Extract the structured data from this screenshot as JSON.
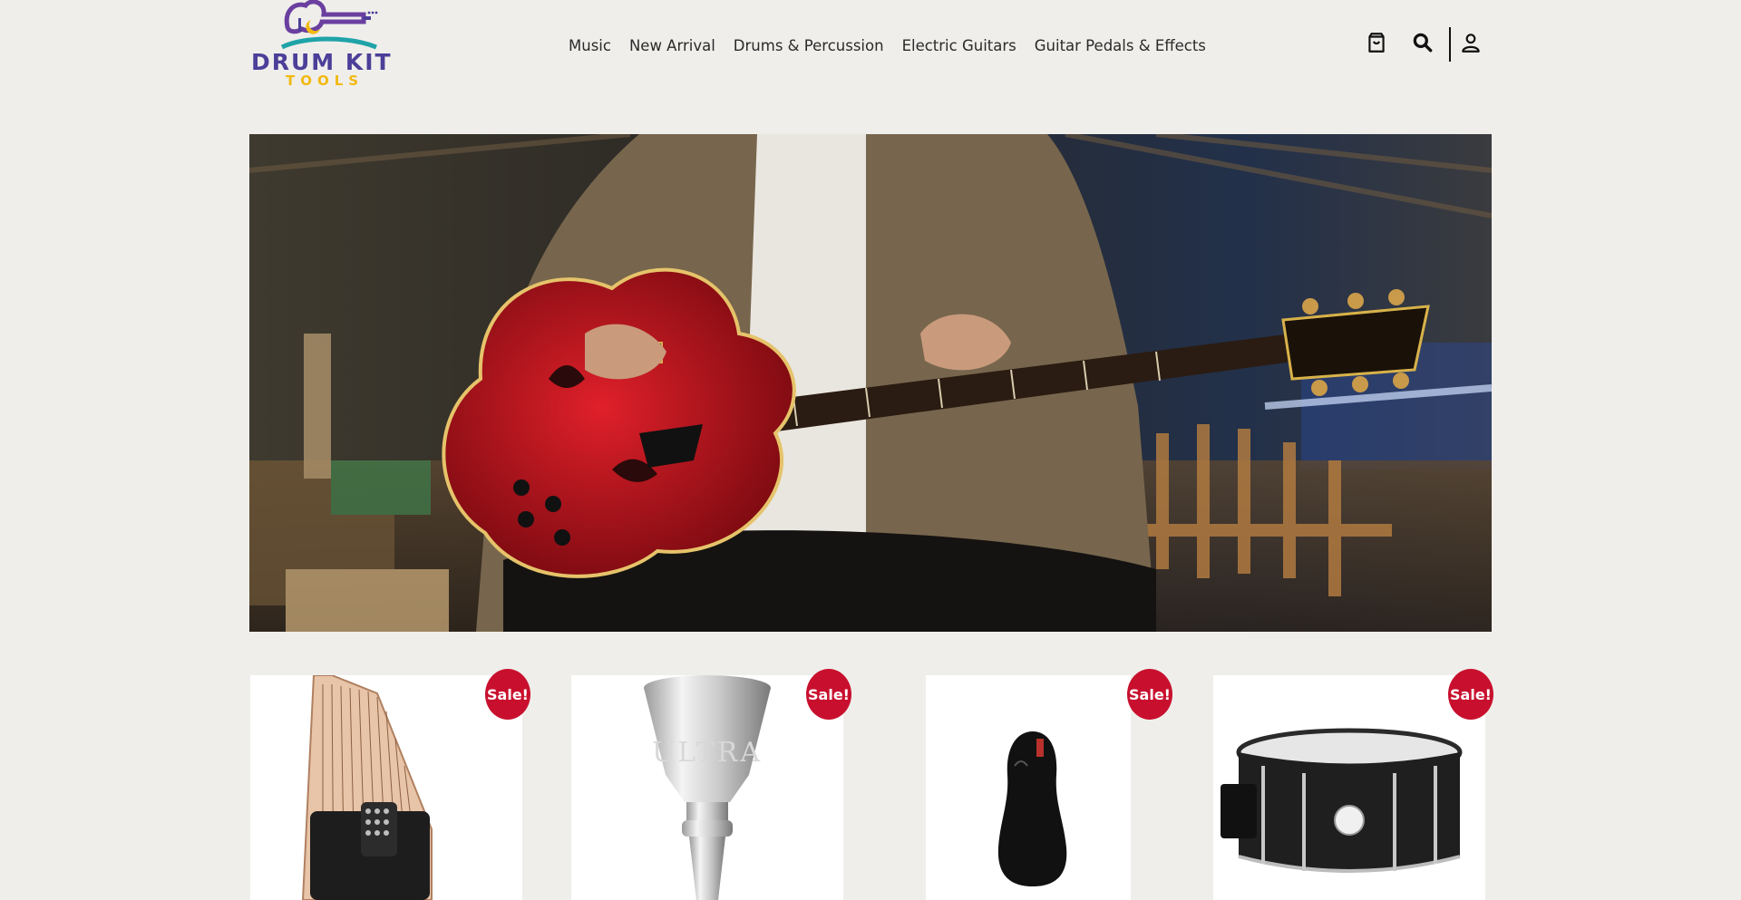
{
  "brand": {
    "name": "DRUM KIT",
    "tagline": "TOOLS"
  },
  "nav": {
    "items": [
      {
        "label": "Music"
      },
      {
        "label": "New Arrival"
      },
      {
        "label": "Drums & Percussion"
      },
      {
        "label": "Electric Guitars"
      },
      {
        "label": "Guitar Pedals & Effects"
      }
    ]
  },
  "header_icons": [
    "cart-icon",
    "search-icon",
    "account-icon"
  ],
  "hero": {
    "image": "man-playing-red-hollow-body-guitar"
  },
  "products": [
    {
      "badge": "Sale!",
      "image": "autoharp"
    },
    {
      "badge": "Sale!",
      "image": "brass-mouthpiece",
      "engraving": "ULTRA"
    },
    {
      "badge": "Sale!",
      "image": "violin-case"
    },
    {
      "badge": "Sale!",
      "image": "snare-drum"
    }
  ],
  "colors": {
    "background": "#efeeeb",
    "sale_badge": "#c8102e",
    "logo_purple": "#4b3f99",
    "logo_yellow": "#f2b90f",
    "logo_teal": "#1fa3a8"
  }
}
